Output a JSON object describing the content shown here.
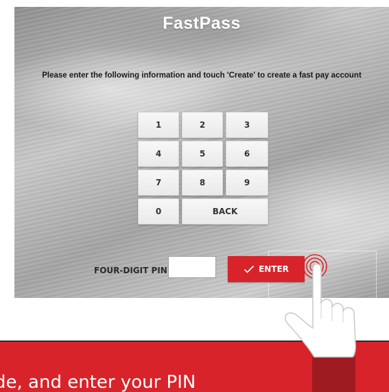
{
  "kiosk": {
    "title": "FastPass",
    "instruction": "Please enter the following information and touch 'Create' to create a fast pay account"
  },
  "keypad": {
    "keys": [
      "1",
      "2",
      "3",
      "4",
      "5",
      "6",
      "7",
      "8",
      "9",
      "0",
      "BACK"
    ]
  },
  "pin": {
    "label": "FOUR-DIGIT PIN:",
    "value": ""
  },
  "enter_button": {
    "label": "ENTER",
    "icon": "checkmark-icon"
  },
  "caption": {
    "text": "de, and enter your PIN"
  },
  "colors": {
    "accent_red": "#d8232a",
    "sleeve_dark_red": "#9e1b22",
    "key_face": "#f2f2f2"
  },
  "icons": [
    "checkmark-icon",
    "pointing-hand-icon",
    "tap-ripple-icon"
  ]
}
